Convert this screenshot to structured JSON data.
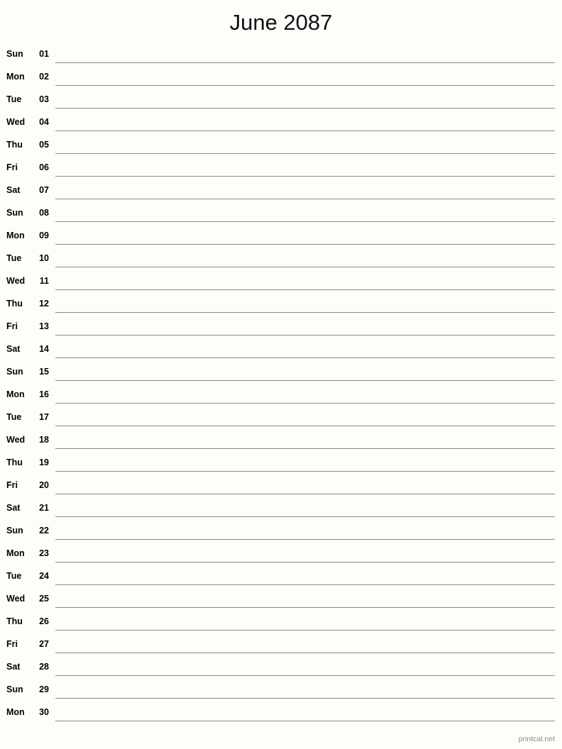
{
  "header": {
    "title": "June 2087",
    "month": "June",
    "year": "2087"
  },
  "calendar": {
    "type": "single-column-notes-calendar",
    "days_in_month": 30,
    "first_weekday": "Sun",
    "rows": [
      {
        "weekday": "Sun",
        "date": "01"
      },
      {
        "weekday": "Mon",
        "date": "02"
      },
      {
        "weekday": "Tue",
        "date": "03"
      },
      {
        "weekday": "Wed",
        "date": "04"
      },
      {
        "weekday": "Thu",
        "date": "05"
      },
      {
        "weekday": "Fri",
        "date": "06"
      },
      {
        "weekday": "Sat",
        "date": "07"
      },
      {
        "weekday": "Sun",
        "date": "08"
      },
      {
        "weekday": "Mon",
        "date": "09"
      },
      {
        "weekday": "Tue",
        "date": "10"
      },
      {
        "weekday": "Wed",
        "date": "11"
      },
      {
        "weekday": "Thu",
        "date": "12"
      },
      {
        "weekday": "Fri",
        "date": "13"
      },
      {
        "weekday": "Sat",
        "date": "14"
      },
      {
        "weekday": "Sun",
        "date": "15"
      },
      {
        "weekday": "Mon",
        "date": "16"
      },
      {
        "weekday": "Tue",
        "date": "17"
      },
      {
        "weekday": "Wed",
        "date": "18"
      },
      {
        "weekday": "Thu",
        "date": "19"
      },
      {
        "weekday": "Fri",
        "date": "20"
      },
      {
        "weekday": "Sat",
        "date": "21"
      },
      {
        "weekday": "Sun",
        "date": "22"
      },
      {
        "weekday": "Mon",
        "date": "23"
      },
      {
        "weekday": "Tue",
        "date": "24"
      },
      {
        "weekday": "Wed",
        "date": "25"
      },
      {
        "weekday": "Thu",
        "date": "26"
      },
      {
        "weekday": "Fri",
        "date": "27"
      },
      {
        "weekday": "Sat",
        "date": "28"
      },
      {
        "weekday": "Sun",
        "date": "29"
      },
      {
        "weekday": "Mon",
        "date": "30"
      }
    ]
  },
  "footer": {
    "credit": "printcal.net"
  },
  "colors": {
    "background": "#fdfdfa",
    "text": "#000000",
    "rule_line": "#8a8a8a",
    "footer_text": "#8a8a8a"
  }
}
